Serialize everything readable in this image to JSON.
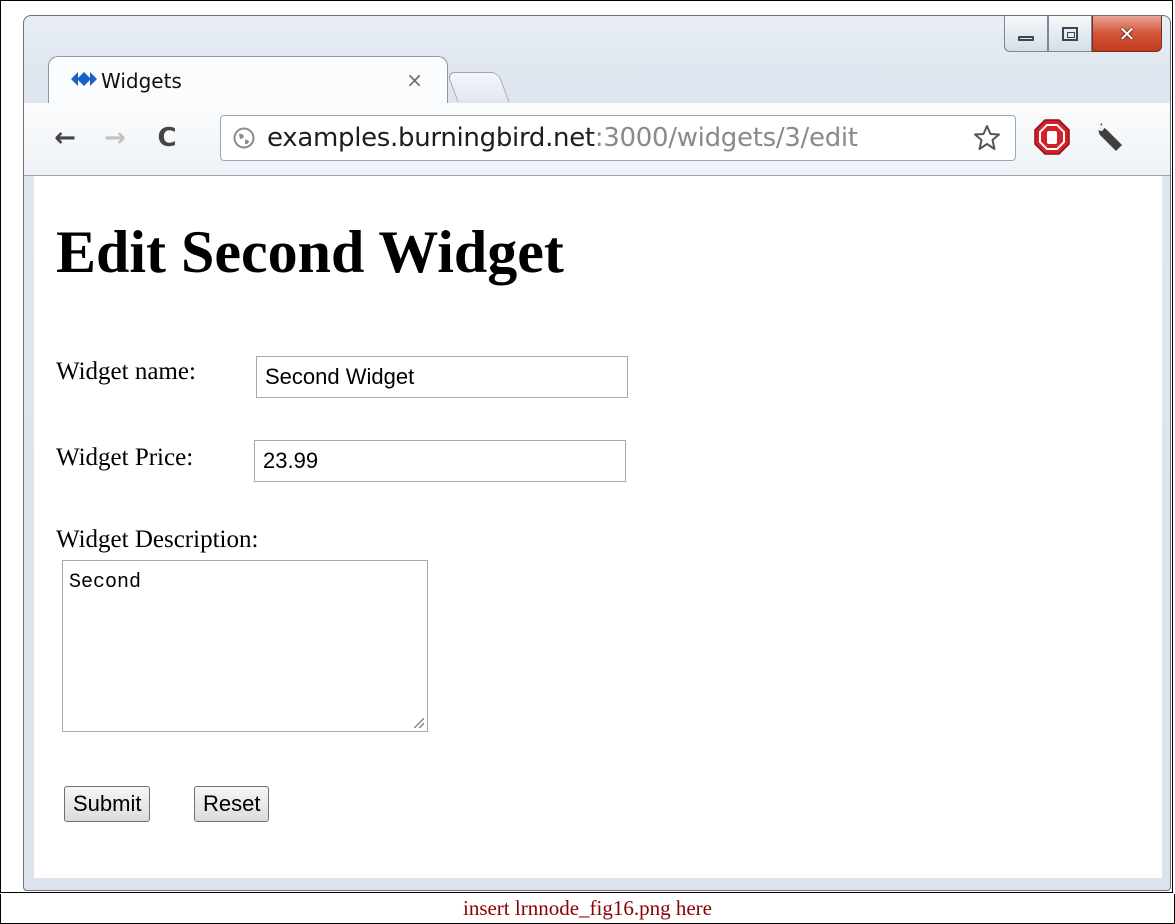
{
  "window": {
    "minimize_label": "",
    "maximize_label": "",
    "close_glyph": "✕"
  },
  "tab": {
    "title": "Widgets",
    "close_glyph": "×"
  },
  "toolbar": {
    "back_glyph": "←",
    "forward_glyph": "→",
    "reload_glyph": "C",
    "url_host": "examples.burningbird.net",
    "url_rest": ":3000/widgets/3/edit"
  },
  "page": {
    "title": "Edit Second Widget",
    "name_label": "Widget name:",
    "name_value": "Second Widget",
    "price_label": "Widget Price:",
    "price_value": "23.99",
    "description_label": "Widget Description:",
    "description_value": "Second",
    "submit_label": "Submit",
    "reset_label": "Reset"
  },
  "caption": "insert lrnnode_fig16.png here",
  "colors": {
    "caption": "#8b0000",
    "favicon": "#1a63c6",
    "stop": "#d4202a"
  }
}
